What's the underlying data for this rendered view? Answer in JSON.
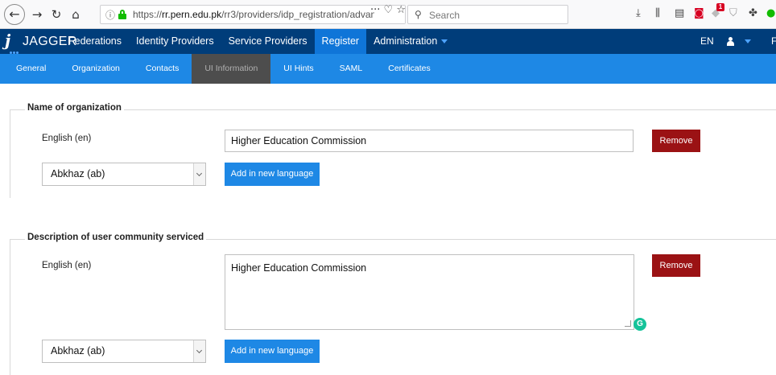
{
  "browser": {
    "url_host": "rr.pern.edu.pk",
    "url_path": "/rr3/providers/idp_registration/advan",
    "search_placeholder": "Search",
    "actions_text": "··· ♡ ☆",
    "badge_count": "1",
    "icons": [
      "back-icon",
      "forward-icon",
      "reload-icon",
      "home-icon",
      "info-icon",
      "lock-icon",
      "search-icon",
      "download-icon",
      "library-icon",
      "reader-icon",
      "pocket-icon",
      "shield-icon",
      "extension-icon"
    ]
  },
  "app": {
    "logo_text": "JAGGER",
    "logo_letter": "j",
    "main_nav": [
      {
        "label": "Federations"
      },
      {
        "label": "Identity Providers"
      },
      {
        "label": "Service Providers"
      },
      {
        "label": "Register"
      },
      {
        "label": "Administration"
      }
    ],
    "active_main": "Register",
    "language": "EN",
    "edge_mark": "F",
    "colors": {
      "header_bg": "#003d7a",
      "subnav_bg": "#1e88e5",
      "active_tab_bg": "#4d4d4d",
      "remove_btn": "#9b1214",
      "add_btn": "#1e88e5"
    }
  },
  "sub_nav": [
    {
      "label": "General"
    },
    {
      "label": "Organization"
    },
    {
      "label": "Contacts"
    },
    {
      "label": "UI Information"
    },
    {
      "label": "UI Hints"
    },
    {
      "label": "SAML"
    },
    {
      "label": "Certificates"
    }
  ],
  "active_sub": "UI Information",
  "sections": {
    "org_name": {
      "legend": "Name of organization",
      "entry_language": "English (en)",
      "entry_value": "Higher Education Commission",
      "remove_label": "Remove",
      "select_value": "Abkhaz (ab)",
      "add_label": "Add in new language"
    },
    "description": {
      "legend": "Description of user community serviced",
      "entry_language": "English (en)",
      "entry_value": "Higher Education Commission",
      "remove_label": "Remove",
      "select_value": "Abkhaz (ab)",
      "add_label": "Add in new language",
      "assist_icon_letter": "G"
    }
  }
}
